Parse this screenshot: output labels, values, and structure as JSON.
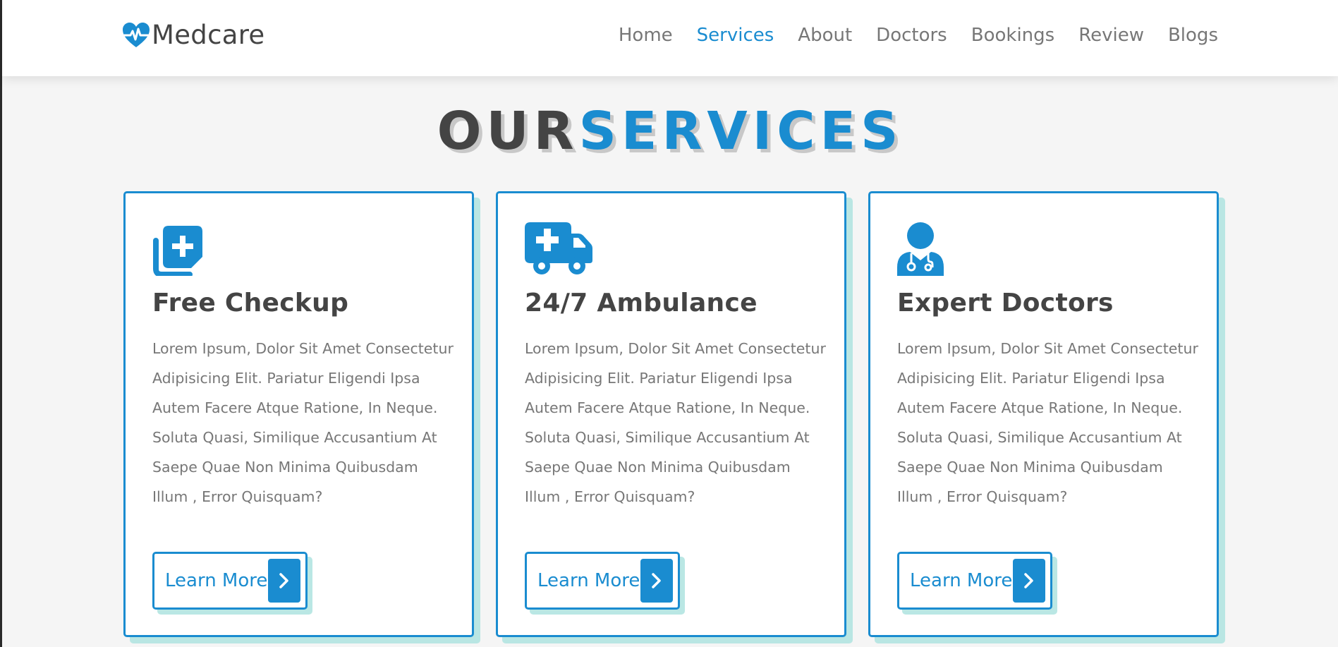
{
  "header": {
    "brand": "Medcare",
    "brand_icon": "heartbeat-icon",
    "nav": [
      {
        "label": "Home",
        "active": false
      },
      {
        "label": "Services",
        "active": true
      },
      {
        "label": "About",
        "active": false
      },
      {
        "label": "Doctors",
        "active": false
      },
      {
        "label": "Bookings",
        "active": false
      },
      {
        "label": "Review",
        "active": false
      },
      {
        "label": "Blogs",
        "active": false
      }
    ]
  },
  "section": {
    "title_part1": "OUR",
    "title_part2": "SERVICES"
  },
  "cards": [
    {
      "icon": "notes-medical-icon",
      "title": "Free Checkup",
      "description": "Lorem Ipsum, Dolor Sit Amet Consectetur Adipisicing Elit. Pariatur Eligendi Ipsa Autem Facere Atque Ratione, In Neque. Soluta Quasi, Similique Accusantium At Saepe Quae Non Minima Quibusdam Illum , Error Quisquam?",
      "button_label": "Learn More"
    },
    {
      "icon": "ambulance-icon",
      "title": "24/7 Ambulance",
      "description": "Lorem Ipsum, Dolor Sit Amet Consectetur Adipisicing Elit. Pariatur Eligendi Ipsa Autem Facere Atque Ratione, In Neque. Soluta Quasi, Similique Accusantium At Saepe Quae Non Minima Quibusdam Illum , Error Quisquam?",
      "button_label": "Learn More"
    },
    {
      "icon": "user-doctor-icon",
      "title": "Expert Doctors",
      "description": "Lorem Ipsum, Dolor Sit Amet Consectetur Adipisicing Elit. Pariatur Eligendi Ipsa Autem Facere Atque Ratione, In Neque. Soluta Quasi, Similique Accusantium At Saepe Quae Non Minima Quibusdam Illum , Error Quisquam?",
      "button_label": "Learn More"
    }
  ],
  "colors": {
    "accent": "#1a8cd0",
    "heading": "#444444",
    "body_text": "#777777",
    "card_shadow": "#b2e4e1",
    "background": "#f5f5f5"
  }
}
